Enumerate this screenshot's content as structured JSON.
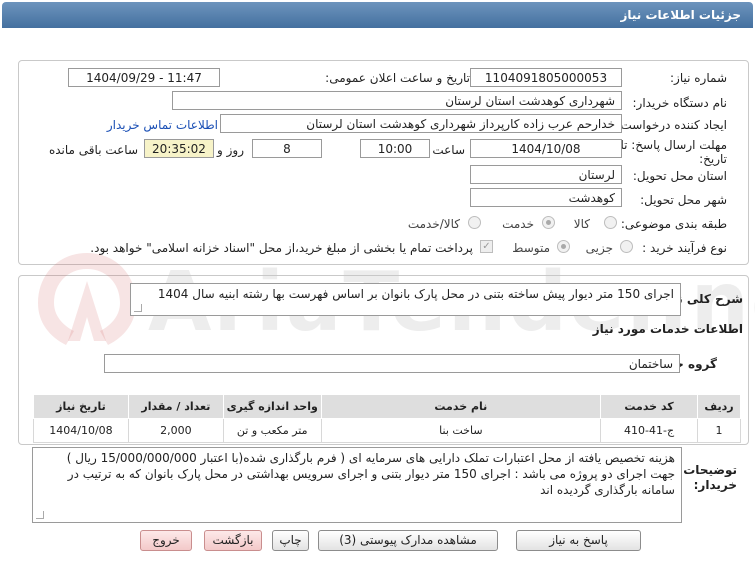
{
  "window": {
    "title": "جزئیات اطلاعات نیاز"
  },
  "labels": {
    "need_number": "شماره نیاز:",
    "announce_datetime": "تاریخ و ساعت اعلان عمومی:",
    "buyer_org": "نام دستگاه خریدار:",
    "requester": "ایجاد کننده درخواست:",
    "reply_deadline_line1": "مهلت ارسال پاسخ: تا",
    "reply_deadline_line2": "تاریخ:",
    "time": "ساعت",
    "days_and": "روز و",
    "remaining": "ساعت باقی مانده",
    "province": "استان محل تحویل:",
    "city": "شهر محل تحویل:",
    "category": "طبقه بندی موضوعی:",
    "process_type": "نوع فرآیند خرید :",
    "general_desc": "شرح کلی نیاز:",
    "services_info": "اطلاعات خدمات مورد نیاز",
    "service_group": "گروه خدمت:",
    "buyer_notes_line1": "توضیحات",
    "buyer_notes_line2": "خریدار:"
  },
  "values": {
    "need_number": "1104091805000053",
    "announce_datetime": "1404/09/29 - 11:47",
    "buyer_org": "شهرداری کوهدشت استان لرستان",
    "requester": "خدارحم عرب زاده کارپرداز شهرداری کوهدشت استان لرستان",
    "contact_link": "اطلاعات تماس خریدار",
    "deadline_date": "1404/10/08",
    "deadline_time": "10:00",
    "days": "8",
    "remaining_time": "20:35:02",
    "province": "لرستان",
    "city": "کوهدشت",
    "general_desc": "اجرای 150 متر دیوار پیش ساخته بتنی در محل پارک بانوان بر اساس فهرست بها رشته ابنیه سال 1404",
    "service_group": "ساختمان",
    "buyer_notes": "هزینه تخصیص یافته از محل اعتبارات تملک دارایی های سرمایه ای ( فرم بارگذاری شده(با اعتبار 15/000/000/000 ریال ) جهت اجرای دو پروژه می باشد : اجرای 150 متر دیوار بتنی و اجرای سرویس بهداشتی در محل پارک بانوان که به ترتیب در سامانه بارگذاری گردیده اند"
  },
  "category_options": [
    {
      "label": "کالا",
      "selected": false
    },
    {
      "label": "خدمت",
      "selected": true
    },
    {
      "label": "کالا/خدمت",
      "selected": false
    }
  ],
  "process_options": [
    {
      "label": "جزیی",
      "selected": false
    },
    {
      "label": "متوسط",
      "selected": true
    }
  ],
  "payment_note": "پرداخت تمام یا بخشی از مبلغ خرید،از محل \"اسناد خزانه اسلامی\" خواهد بود.",
  "table": {
    "headers": [
      "ردیف",
      "کد خدمت",
      "نام خدمت",
      "واحد اندازه گیری",
      "تعداد / مقدار",
      "تاریخ نیاز"
    ],
    "rows": [
      [
        "1",
        "ج-41-410",
        "ساخت بنا",
        "متر مکعب و تن",
        "2,000",
        "1404/10/08"
      ]
    ]
  },
  "buttons": {
    "reply": "پاسخ به نیاز",
    "view_docs": "مشاهده مدارک پیوستی (3)",
    "print": "چاپ",
    "back": "بازگشت",
    "exit": "خروج"
  },
  "watermark": "AriaTender.net"
}
